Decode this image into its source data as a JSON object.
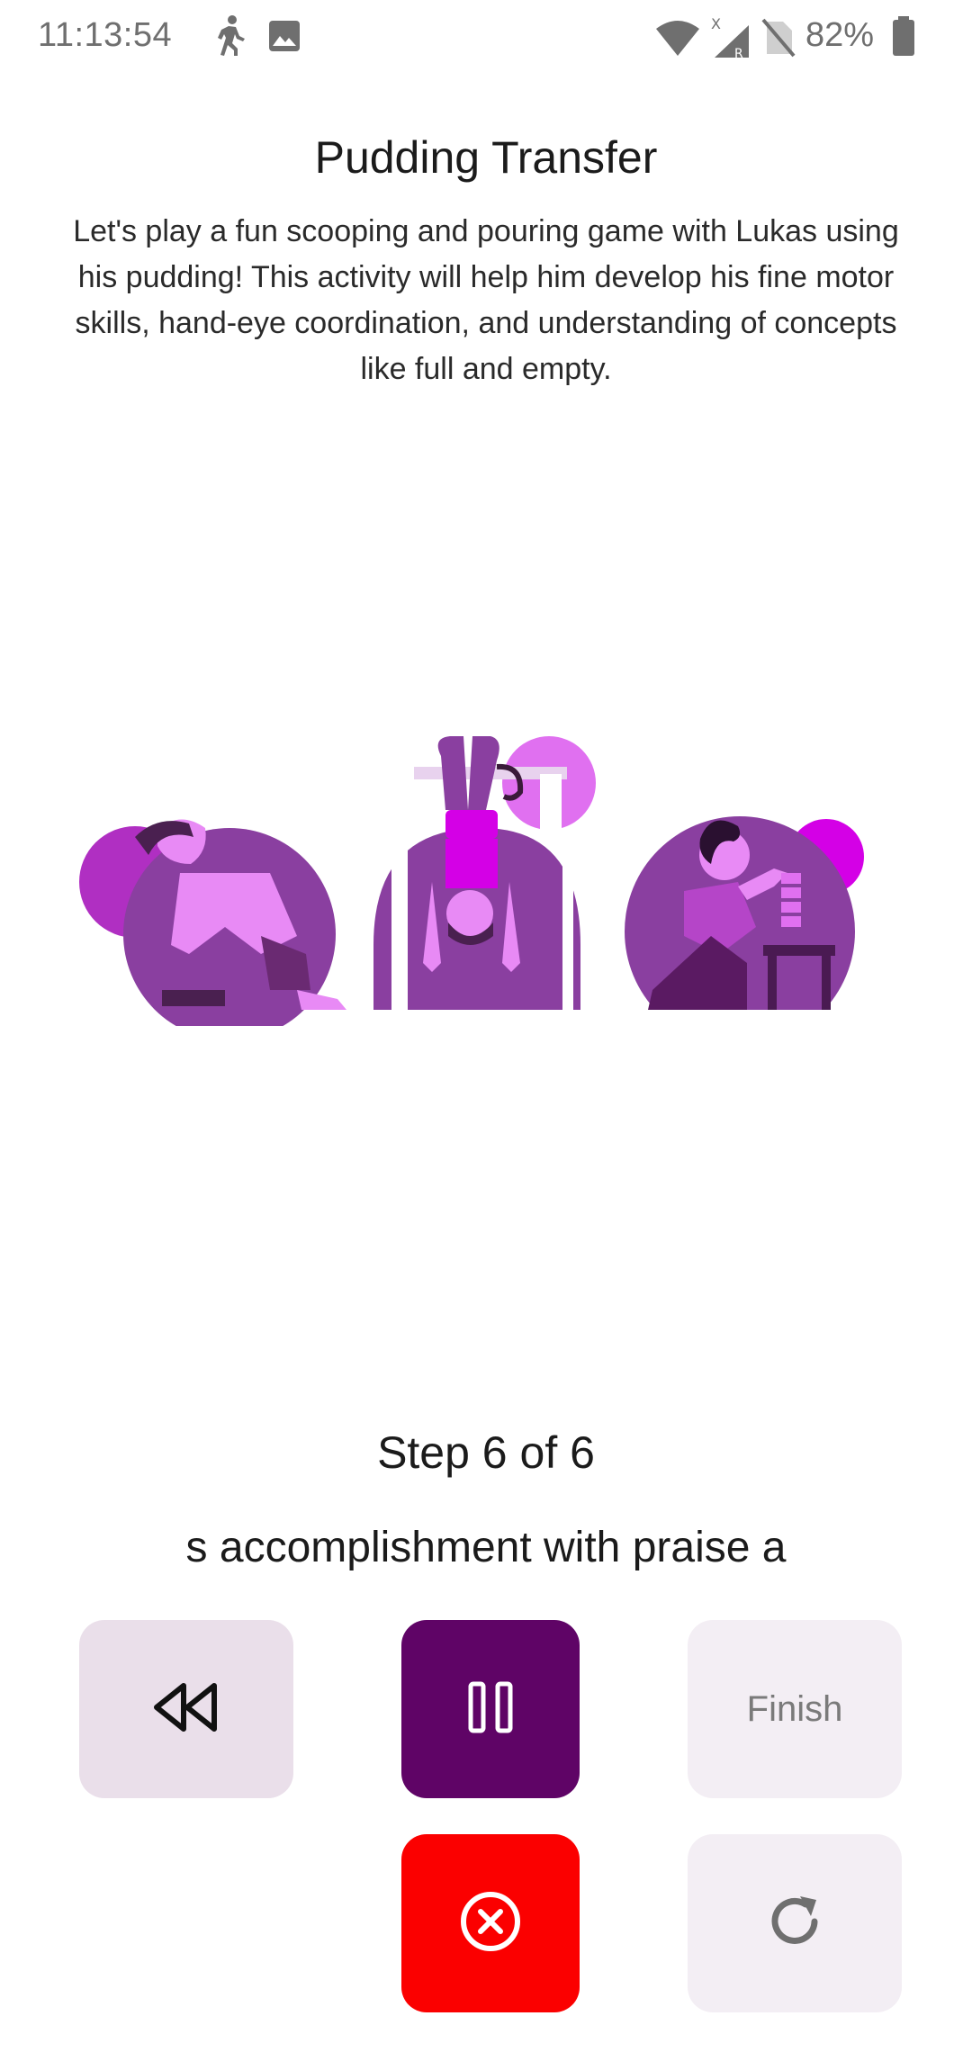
{
  "status_bar": {
    "time": "11:13:54",
    "left_icons": [
      "walking-person-icon",
      "image-icon"
    ],
    "right_icons": [
      "wifi-icon",
      "cell-signal-roaming-icon",
      "no-sim-icon",
      "battery-icon"
    ],
    "battery": "82%"
  },
  "activity": {
    "title": "Pudding Transfer",
    "description": "Let's play a fun scooping and pouring game with Lukas using his pudding! This activity will help him develop his fine motor skills, hand-eye coordination, and understanding of concepts like full and empty."
  },
  "illustration": {
    "description": "three-kids-playing-illustration",
    "colors": {
      "dark_purple": "#8a3fa0",
      "mid_purple": "#b545c8",
      "light_purple": "#e070f0",
      "magenta": "#d400e6"
    }
  },
  "step": {
    "label": "Step 6 of 6",
    "text": "s accomplishment with praise a"
  },
  "controls": {
    "rewind_icon": "rewind-icon",
    "pause_icon": "pause-icon",
    "finish_label": "Finish",
    "cancel_icon": "cancel-circle-x-icon",
    "restart_icon": "restart-icon",
    "colors": {
      "rewind_bg": "#eadfea",
      "pause_bg": "#5f0466",
      "finish_bg": "#f3eef4",
      "cancel_bg": "#fb0000",
      "restart_bg": "#f3eef4"
    }
  }
}
